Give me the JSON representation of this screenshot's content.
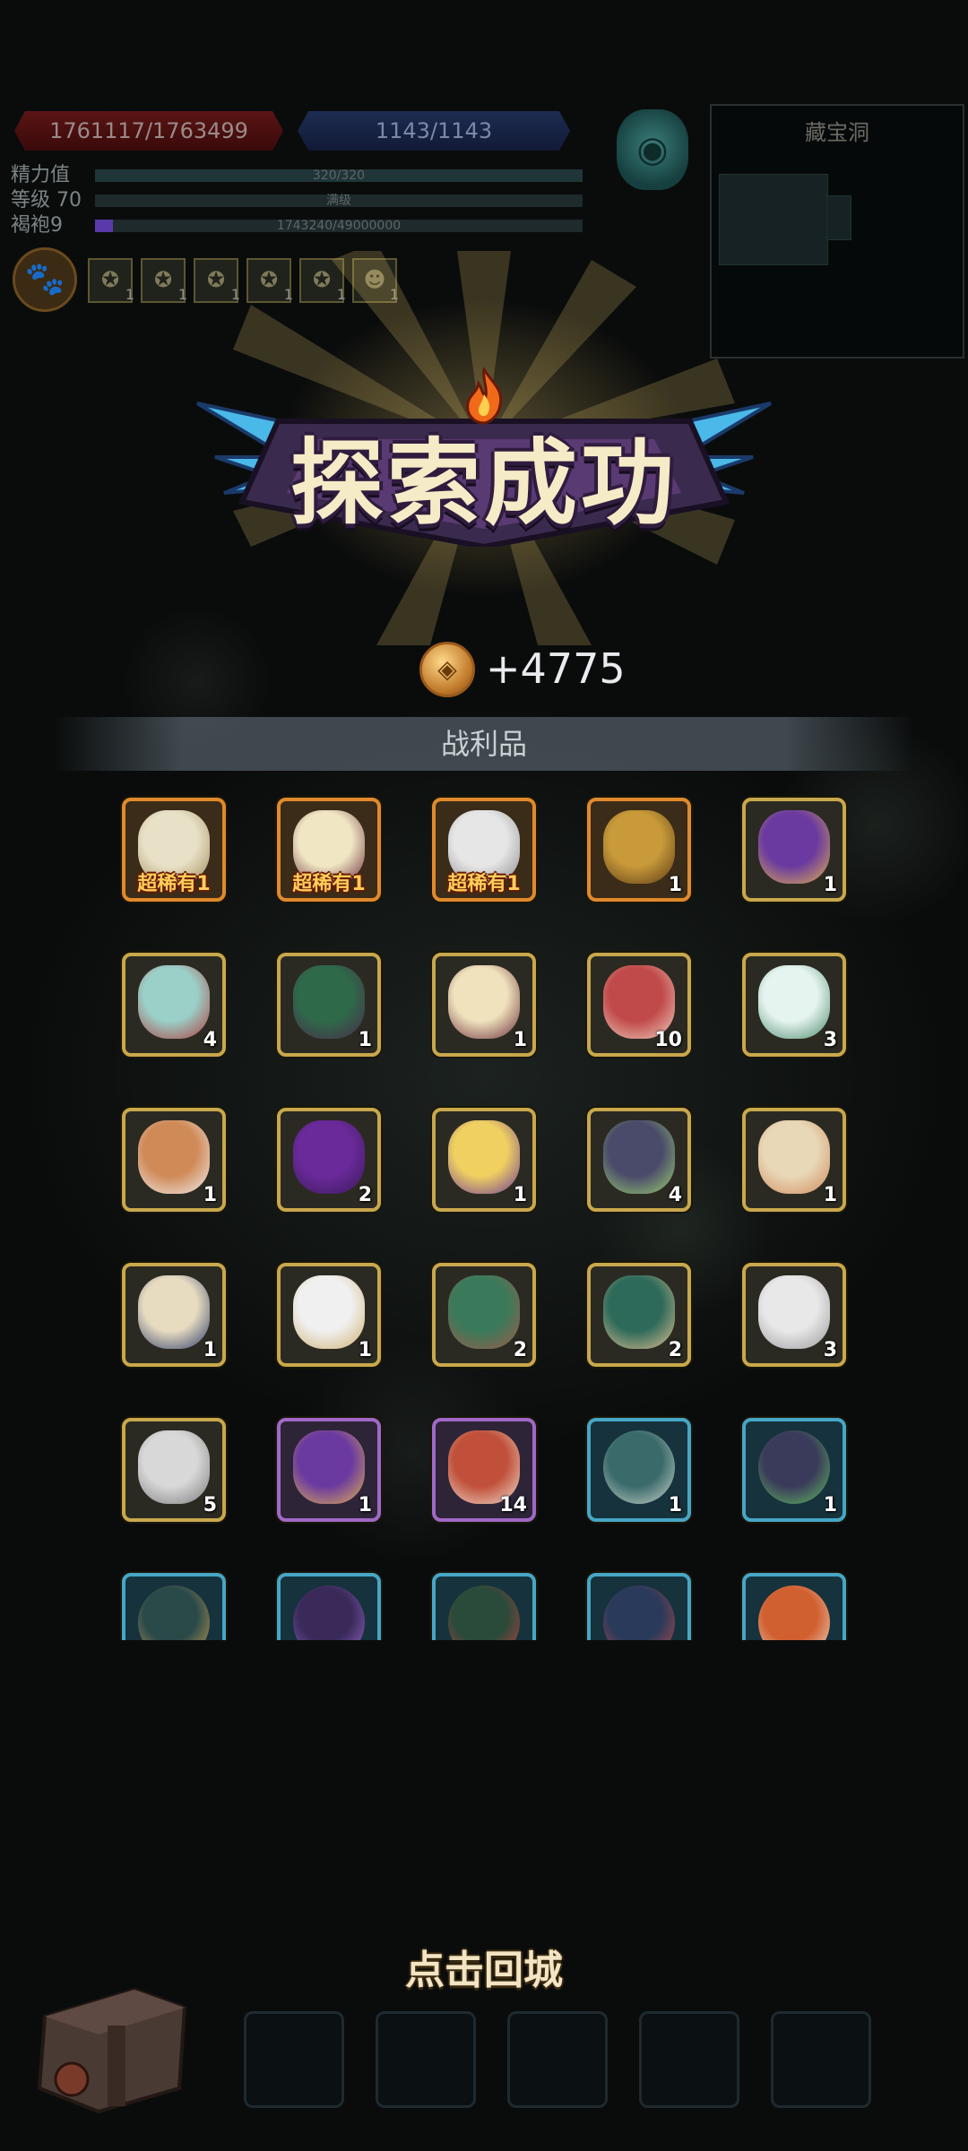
{
  "hud": {
    "hp": "1761117/1763499",
    "mp": "1143/1143",
    "stats": [
      {
        "label": "精力值",
        "text": "320/320",
        "fraction": 1.0,
        "color": "#1f3538"
      },
      {
        "label": "等级 70",
        "text": "满级",
        "fraction": 0,
        "color": "#1f3538"
      },
      {
        "label": "褐袍9",
        "text": "1743240/49000000",
        "fraction": 0.036,
        "color": "#5a3aa8"
      }
    ],
    "buffs": [
      {
        "icon": "star-medal-icon",
        "count": "1"
      },
      {
        "icon": "star-medal-icon",
        "count": "1"
      },
      {
        "icon": "star-medal-icon",
        "count": "1"
      },
      {
        "icon": "star-medal-icon",
        "count": "1"
      },
      {
        "icon": "star-medal-icon",
        "count": "1"
      },
      {
        "icon": "ghost-icon",
        "count": "1"
      }
    ]
  },
  "minimap": {
    "title": "藏宝洞"
  },
  "banner": {
    "title": "探索成功"
  },
  "reward": {
    "coin_amount": "+4775"
  },
  "loot": {
    "header": "战利品",
    "rare_label": "超稀有",
    "items": [
      {
        "name": "spiky-egg",
        "qty": "1",
        "frame": "orange",
        "rare": true,
        "c1": "#e8e1c8",
        "c2": "#a08a58"
      },
      {
        "name": "horned-egg",
        "qty": "1",
        "frame": "orange",
        "rare": true,
        "c1": "#f0e6c4",
        "c2": "#6a2a3a"
      },
      {
        "name": "whirl-egg",
        "qty": "1",
        "frame": "orange",
        "rare": true,
        "c1": "#e6e6e6",
        "c2": "#8a8a8a"
      },
      {
        "name": "golden-urn",
        "qty": "1",
        "frame": "orange",
        "rare": false,
        "c1": "#c89a3a",
        "c2": "#5a3a14"
      },
      {
        "name": "spell-book",
        "qty": "1",
        "frame": "gold",
        "rare": false,
        "c1": "#6a3aa0",
        "c2": "#e0b050"
      },
      {
        "name": "armored-egg",
        "qty": "4",
        "frame": "gold",
        "rare": false,
        "c1": "#9ad0c8",
        "c2": "#b03a3a"
      },
      {
        "name": "leaf-egg",
        "qty": "1",
        "frame": "gold",
        "rare": false,
        "c1": "#2e6a4a",
        "c2": "#4a2a4a"
      },
      {
        "name": "horned-egg",
        "qty": "1",
        "frame": "gold",
        "rare": false,
        "c1": "#efe2bc",
        "c2": "#6a2a3a"
      },
      {
        "name": "meat-steak",
        "qty": "10",
        "frame": "gold",
        "rare": false,
        "c1": "#c04a4a",
        "c2": "#f0d0c0"
      },
      {
        "name": "vine-egg",
        "qty": "3",
        "frame": "gold",
        "rare": false,
        "c1": "#e6f4f0",
        "c2": "#4a8a6a"
      },
      {
        "name": "clawed-egg",
        "qty": "1",
        "frame": "gold",
        "rare": false,
        "c1": "#d08a58",
        "c2": "#f0f0f0"
      },
      {
        "name": "shadow-egg",
        "qty": "2",
        "frame": "gold",
        "rare": false,
        "c1": "#6a2a9a",
        "c2": "#3a1a5a"
      },
      {
        "name": "star-crystal",
        "qty": "1",
        "frame": "gold",
        "rare": false,
        "c1": "#f0d060",
        "c2": "#6a3a9a"
      },
      {
        "name": "dark-horned-egg",
        "qty": "4",
        "frame": "gold",
        "rare": false,
        "c1": "#4a4a6a",
        "c2": "#9ad070"
      },
      {
        "name": "scale-egg",
        "qty": "1",
        "frame": "gold",
        "rare": false,
        "c1": "#e8d8b8",
        "c2": "#d08a5a"
      },
      {
        "name": "wizard-egg",
        "qty": "1",
        "frame": "gold",
        "rare": false,
        "c1": "#e8dcc0",
        "c2": "#2a3a6a"
      },
      {
        "name": "sage-portrait",
        "qty": "1",
        "frame": "gold",
        "rare": false,
        "c1": "#f0f0f0",
        "c2": "#d0b070"
      },
      {
        "name": "moss-egg",
        "qty": "2",
        "frame": "gold",
        "rare": false,
        "c1": "#3a7a5a",
        "c2": "#a05a4a"
      },
      {
        "name": "fluffy-egg",
        "qty": "2",
        "frame": "gold",
        "rare": false,
        "c1": "#2e6a5a",
        "c2": "#e0c090"
      },
      {
        "name": "cloud-egg",
        "qty": "3",
        "frame": "gold",
        "rare": false,
        "c1": "#e8e8e8",
        "c2": "#9a9a9a"
      },
      {
        "name": "furry-egg",
        "qty": "5",
        "frame": "gold",
        "rare": false,
        "c1": "#d8d8d8",
        "c2": "#7a7a7a"
      },
      {
        "name": "spell-book",
        "qty": "1",
        "frame": "purple",
        "rare": false,
        "c1": "#6a3aa0",
        "c2": "#e0b050"
      },
      {
        "name": "meat-drumstick",
        "qty": "14",
        "frame": "purple",
        "rare": false,
        "c1": "#c0503a",
        "c2": "#f0e0d0"
      },
      {
        "name": "knight-portrait",
        "qty": "1",
        "frame": "cyan",
        "rare": false,
        "c1": "#3a6a6a",
        "c2": "#d0d8d0"
      },
      {
        "name": "spiral-orb",
        "qty": "1",
        "frame": "cyan",
        "rare": false,
        "c1": "#3a3a5a",
        "c2": "#60c060"
      },
      {
        "name": "goblin-portrait",
        "qty": "",
        "frame": "cyan",
        "rare": false,
        "c1": "#2a4a4a",
        "c2": "#d0a050"
      },
      {
        "name": "imp-portrait",
        "qty": "",
        "frame": "cyan",
        "rare": false,
        "c1": "#3a2a5a",
        "c2": "#9a6ad0"
      },
      {
        "name": "beast-portrait",
        "qty": "",
        "frame": "cyan",
        "rare": false,
        "c1": "#2a4a3a",
        "c2": "#c04040"
      },
      {
        "name": "dragon-portrait",
        "qty": "",
        "frame": "cyan",
        "rare": false,
        "c1": "#2a3a5a",
        "c2": "#c04a4a"
      },
      {
        "name": "meat-drumstick",
        "qty": "",
        "frame": "cyan",
        "rare": false,
        "c1": "#d06030",
        "c2": "#f0e0d0"
      }
    ]
  },
  "footer": {
    "back_label": "点击回城",
    "slots": 5
  }
}
